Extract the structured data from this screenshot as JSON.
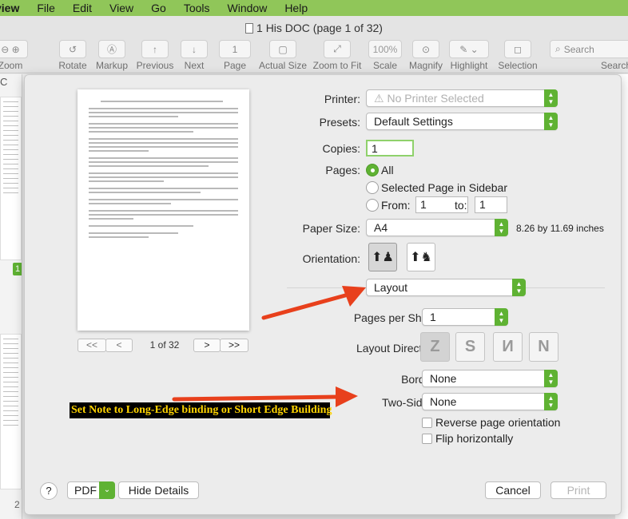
{
  "menubar": {
    "app": "view",
    "items": [
      "File",
      "Edit",
      "View",
      "Go",
      "Tools",
      "Window",
      "Help"
    ]
  },
  "window": {
    "title": "1 His DOC (page 1 of 32)"
  },
  "toolbar": {
    "zoom": "Zoom",
    "rotate": "Rotate",
    "markup": "Markup",
    "previous": "Previous",
    "next": "Next",
    "page_value": "1",
    "page": "Page",
    "actual_size": "Actual Size",
    "zoom_to_fit": "Zoom to Fit",
    "scale_value": "100%",
    "scale": "Scale",
    "magnify": "Magnify",
    "highlight": "Highlight",
    "selection": "Selection",
    "search_placeholder": "Search",
    "search": "Search"
  },
  "sidebar": {
    "badge": "1",
    "footer": "2",
    "left_letter": "C"
  },
  "preview": {
    "page_counter": "1 of 32",
    "first": "<<",
    "prev": "<",
    "next": ">",
    "last": ">>"
  },
  "print": {
    "printer_label": "Printer:",
    "printer_value": "No Printer Selected",
    "presets_label": "Presets:",
    "presets_value": "Default Settings",
    "copies_label": "Copies:",
    "copies_value": "1",
    "pages_label": "Pages:",
    "pages_all": "All",
    "pages_selected": "Selected Page in Sidebar",
    "pages_from": "From:",
    "from_value": "1",
    "pages_to": "to:",
    "to_value": "1",
    "paper_label": "Paper Size:",
    "paper_value": "A4",
    "paper_dims": "8.26 by 11.69 inches",
    "orientation_label": "Orientation:",
    "section_value": "Layout",
    "pps_label": "Pages per Sheet:",
    "pps_value": "1",
    "layout_dir_label": "Layout Direction:",
    "border_label": "Border:",
    "border_value": "None",
    "twosided_label": "Two-Sided:",
    "twosided_value": "None",
    "reverse_label": "Reverse page orientation",
    "flip_label": "Flip horizontally",
    "help": "?",
    "pdf": "PDF",
    "hide_details": "Hide Details",
    "cancel": "Cancel",
    "print": "Print"
  },
  "annotation": {
    "text": "Set Note to Long-Edge binding or Short Edge Building"
  },
  "colors": {
    "menubar": "#90c659",
    "accent": "#5fb233",
    "arrow": "#e8401c",
    "annotation_text": "#ffd400"
  }
}
